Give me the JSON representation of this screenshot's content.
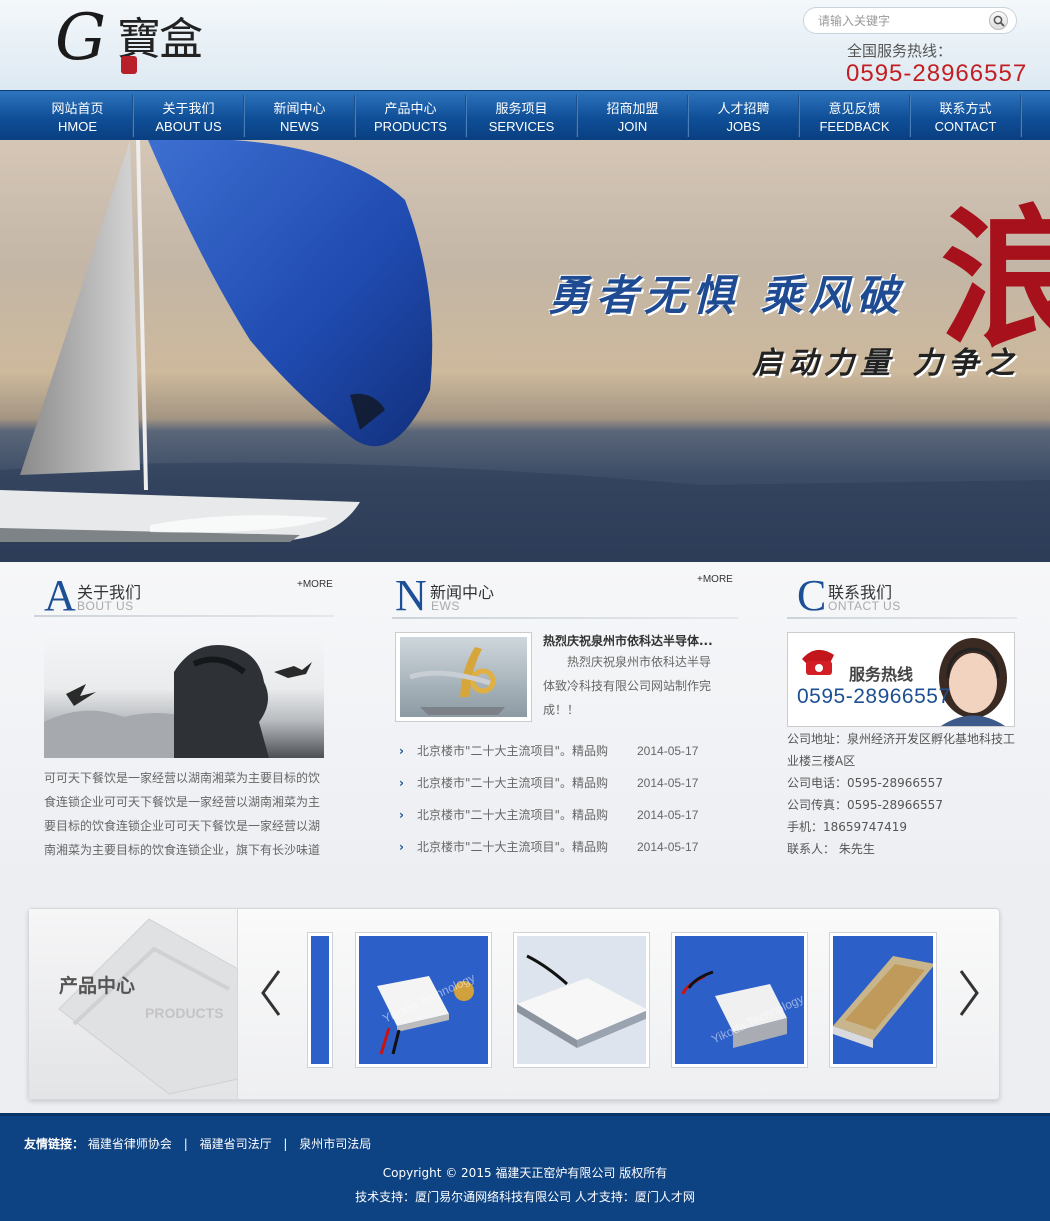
{
  "header": {
    "logo_text": "G寶盒",
    "search_placeholder": "请输入关键字",
    "hotline_label": "全国服务热线：",
    "hotline_number": "0595-28966557"
  },
  "nav": [
    {
      "zh": "网站首页",
      "en": "HMOE"
    },
    {
      "zh": "关于我们",
      "en": "ABOUT US"
    },
    {
      "zh": "新闻中心",
      "en": "NEWS"
    },
    {
      "zh": "产品中心",
      "en": "PRODUCTS"
    },
    {
      "zh": "服务项目",
      "en": "SERVICES"
    },
    {
      "zh": "招商加盟",
      "en": "JOIN"
    },
    {
      "zh": "人才招聘",
      "en": "JOBS"
    },
    {
      "zh": "意见反馈",
      "en": "FEEDBACK"
    },
    {
      "zh": "联系方式",
      "en": "CONTACT"
    }
  ],
  "banner": {
    "slogan_main": "勇者无惧 乘风破",
    "slogan_brush": "浪",
    "slogan_sub": "启动力量 力争之"
  },
  "about": {
    "letter": "A",
    "title": "关于我们",
    "subtitle": "BOUT US",
    "more": "+MORE",
    "text": "可可天下餐饮是一家经营以湖南湘菜为主要目标的饮食连锁企业可可天下餐饮是一家经营以湖南湘菜为主要目标的饮食连锁企业可可天下餐饮是一家经营以湖南湘菜为主要目标的饮食连锁企业，旗下有长沙味道"
  },
  "news": {
    "letter": "N",
    "title": "新闻中心",
    "subtitle": "EWS",
    "more": "+MORE",
    "top_title": "热烈庆祝泉州市依科达半导体...",
    "top_desc": "热烈庆祝泉州市依科达半导体致冷科技有限公司网站制作完成！！",
    "items": [
      {
        "title": "北京楼市\"二十大主流项目\"。精品购",
        "date": "2014-05-17"
      },
      {
        "title": "北京楼市\"二十大主流项目\"。精品购",
        "date": "2014-05-17"
      },
      {
        "title": "北京楼市\"二十大主流项目\"。精品购",
        "date": "2014-05-17"
      },
      {
        "title": "北京楼市\"二十大主流项目\"。精品购",
        "date": "2014-05-17"
      }
    ]
  },
  "contact": {
    "letter": "C",
    "title": "联系我们",
    "subtitle": "ONTACT US",
    "card_label": "服务热线",
    "card_number": "0595-28966557",
    "address": "公司地址：泉州经济开发区孵化基地科技工业楼三楼A区",
    "phone": "公司电话：0595-28966557",
    "fax": "公司传真：0595-28966557",
    "mobile": "手机：18659747419",
    "person": "联系人： 朱先生"
  },
  "products": {
    "title": "产品中心",
    "subtitle": "PRODUCTS",
    "watermark": "Yikoda Technology"
  },
  "footer": {
    "links_label": "友情链接：",
    "links": [
      "福建省律师协会",
      "福建省司法厅",
      "泉州市司法局"
    ],
    "separator": "|",
    "copyright": "Copyright © 2015 福建天正窑炉有限公司 版权所有",
    "tech": "技术支持：厦门易尔通网络科技有限公司 人才支持：厦门人才网"
  },
  "colors": {
    "brand_blue": "#0f4f98",
    "accent_red": "#c31f23",
    "footer_blue": "#0d4283"
  }
}
